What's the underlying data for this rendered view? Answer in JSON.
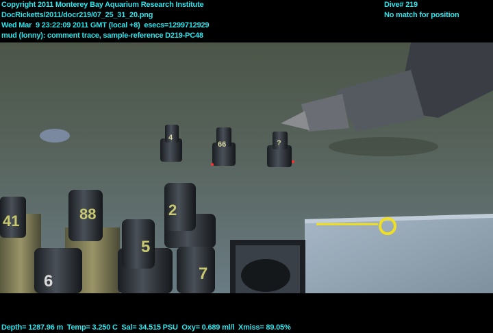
{
  "header": {
    "line1": "Copyright 2011 Monterey Bay Aquarium Research Institute",
    "line2": "DocRicketts/2011/docr219/07_25_31_20.png",
    "line3": "Wed Mar  9 23:22:09 2011 GMT (local +8)  esecs=1299712929",
    "line4": "mud (lonny): comment trace, sample-reference D219-PC48",
    "dive": "Dive# 219",
    "position": "No match for position"
  },
  "footer": {
    "telemetry": "Depth= 1287.96 m  Temp= 3.250 C  Sal= 34.515 PSU  Oxy= 0.689 ml/l  Xmiss= 89.05%"
  },
  "scene": {
    "core_labels": [
      "4",
      "66",
      "?",
      "41",
      "88",
      "2",
      "5",
      "6",
      "7"
    ]
  },
  "colors": {
    "overlay_text": "#30e4ec"
  }
}
